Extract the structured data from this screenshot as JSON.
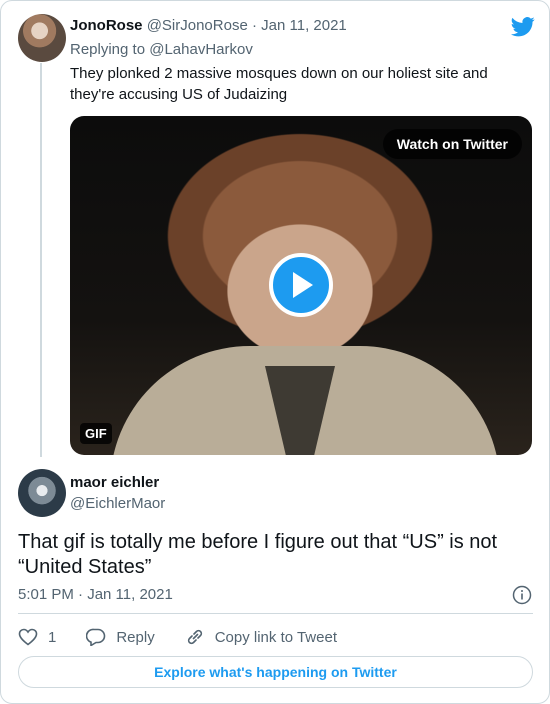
{
  "tweet1": {
    "name": "JonoRose",
    "handle": "@SirJonoRose",
    "separator": " · ",
    "date": "Jan 11, 2021",
    "replying_prefix": "Replying to ",
    "replying_handle": "@LahavHarkov",
    "text": "They plonked 2 massive mosques down on our holiest site and they're accusing US of Judaizing",
    "media": {
      "watch_label": "Watch on Twitter",
      "gif_badge": "GIF"
    }
  },
  "tweet2": {
    "name": "maor eichler",
    "handle": "@EichlerMaor",
    "text": "That gif is totally me before I figure out that “US” is not “United States”",
    "timestamp": "5:01 PM · Jan 11, 2021"
  },
  "actions": {
    "like_count": "1",
    "reply_label": "Reply",
    "copy_label": "Copy link to Tweet"
  },
  "explore_label": "Explore what's happening on Twitter",
  "colors": {
    "accent": "#1d9bf0",
    "secondary_text": "#536471",
    "border": "#cfd9de"
  },
  "icons": [
    "twitter-bird-icon",
    "play-icon",
    "info-icon",
    "heart-icon",
    "reply-icon",
    "link-icon"
  ]
}
